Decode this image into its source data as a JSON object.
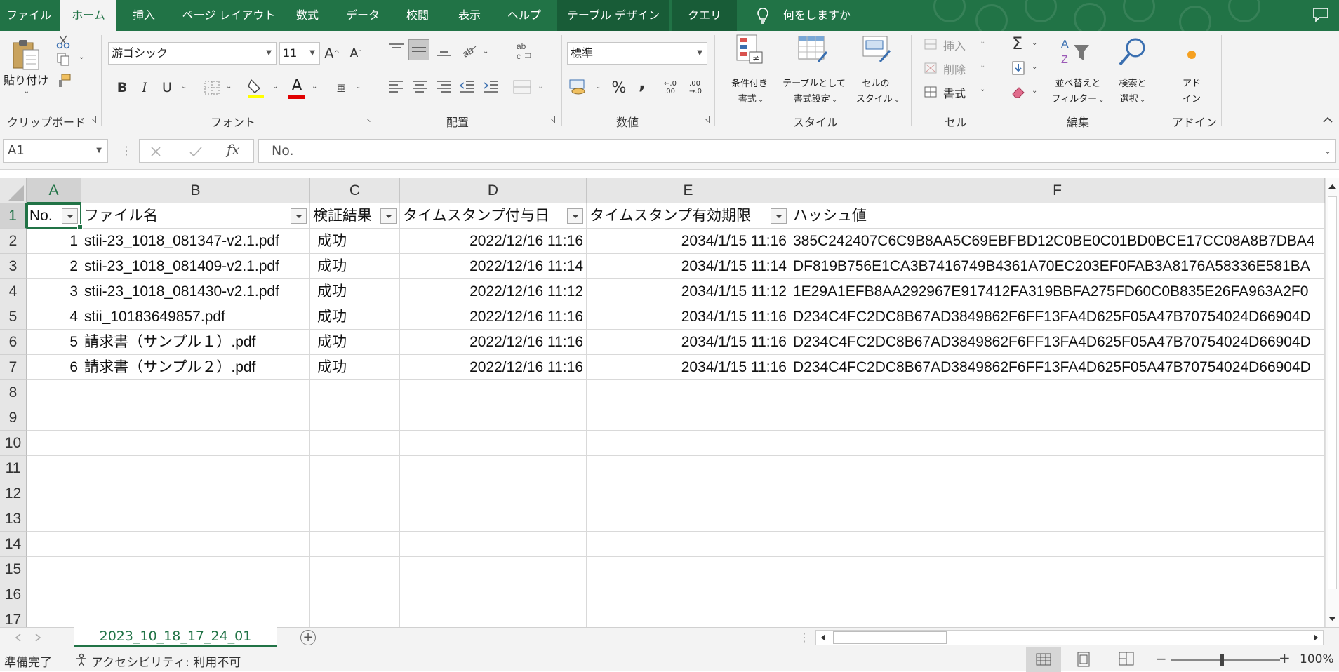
{
  "ribbon_tabs": [
    {
      "label": "ファイル"
    },
    {
      "label": "ホーム"
    },
    {
      "label": "挿入"
    },
    {
      "label": "ページ レイアウト"
    },
    {
      "label": "数式"
    },
    {
      "label": "データ"
    },
    {
      "label": "校閲"
    },
    {
      "label": "表示"
    },
    {
      "label": "ヘルプ"
    },
    {
      "label": "テーブル デザイン"
    },
    {
      "label": "クエリ"
    }
  ],
  "active_tab": "ホーム",
  "tell_me": "何をしますか",
  "ribbon": {
    "clipboard": {
      "label": "クリップボード",
      "paste": "貼り付け"
    },
    "font": {
      "label": "フォント",
      "name": "游ゴシック",
      "size": "11",
      "bold": "B",
      "italic": "I",
      "underline": "U",
      "font_color_glyph": "A"
    },
    "alignment": {
      "label": "配置"
    },
    "number": {
      "label": "数値",
      "format": "標準",
      "percent": "%",
      "comma": ","
    },
    "styles": {
      "label": "スタイル",
      "conditional_line1": "条件付き",
      "conditional_line2": "書式",
      "as_table_line1": "テーブルとして",
      "as_table_line2": "書式設定",
      "cell_styles_line1": "セルの",
      "cell_styles_line2": "スタイル"
    },
    "cells": {
      "label": "セル",
      "insert": "挿入",
      "delete": "削除",
      "format": "書式"
    },
    "editing": {
      "label": "編集",
      "sum": "Σ",
      "sort_line1": "並べ替えと",
      "sort_line2": "フィルター",
      "find_line1": "検索と",
      "find_line2": "選択"
    },
    "addins": {
      "label": "アドイン",
      "line1": "アド",
      "line2": "イン"
    }
  },
  "formula_bar": {
    "name_box": "A1",
    "content": "No."
  },
  "columns": [
    "A",
    "B",
    "C",
    "D",
    "E",
    "F"
  ],
  "rows": [
    "1",
    "2",
    "3",
    "4",
    "5",
    "6",
    "7",
    "8",
    "9",
    "10",
    "11",
    "12",
    "13",
    "14",
    "15",
    "16",
    "17"
  ],
  "table": {
    "headers": [
      "No.",
      "ファイル名",
      "検証結果",
      "タイムスタンプ付与日",
      "タイムスタンプ有効期限",
      "ハッシュ値"
    ],
    "data": [
      [
        "1",
        "stii-23_1018_081347-v2.1.pdf",
        "成功",
        "2022/12/16 11:16",
        "2034/1/15 11:16",
        "385C242407C6C9B8AA5C69EBFBD12C0BE0C01BD0BCE17CC08A8B7DBA4"
      ],
      [
        "2",
        "stii-23_1018_081409-v2.1.pdf",
        "成功",
        "2022/12/16 11:14",
        "2034/1/15 11:14",
        "DF819B756E1CA3B7416749B4361A70EC203EF0FAB3A8176A58336E581BA"
      ],
      [
        "3",
        "stii-23_1018_081430-v2.1.pdf",
        "成功",
        "2022/12/16 11:12",
        "2034/1/15 11:12",
        "1E29A1EFB8AA292967E917412FA319BBFA275FD60C0B835E26FA963A2F0"
      ],
      [
        "4",
        "stii_10183649857.pdf",
        "成功",
        "2022/12/16 11:16",
        "2034/1/15 11:16",
        "D234C4FC2DC8B67AD3849862F6FF13FA4D625F05A47B70754024D66904D"
      ],
      [
        "5",
        "請求書（サンプル１）.pdf",
        "成功",
        "2022/12/16 11:16",
        "2034/1/15 11:16",
        "D234C4FC2DC8B67AD3849862F6FF13FA4D625F05A47B70754024D66904D"
      ],
      [
        "6",
        "請求書（サンプル２）.pdf",
        "成功",
        "2022/12/16 11:16",
        "2034/1/15 11:16",
        "D234C4FC2DC8B67AD3849862F6FF13FA4D625F05A47B70754024D66904D"
      ]
    ]
  },
  "sheet_tab": "2023_10_18_17_24_01",
  "status": {
    "ready": "準備完了",
    "accessibility": "アクセシビリティ: 利用不可",
    "zoom": "100%"
  },
  "colors": {
    "accent": "#217346",
    "context_tab": "#185c37",
    "ribbon_bg": "#f3f3f3"
  }
}
